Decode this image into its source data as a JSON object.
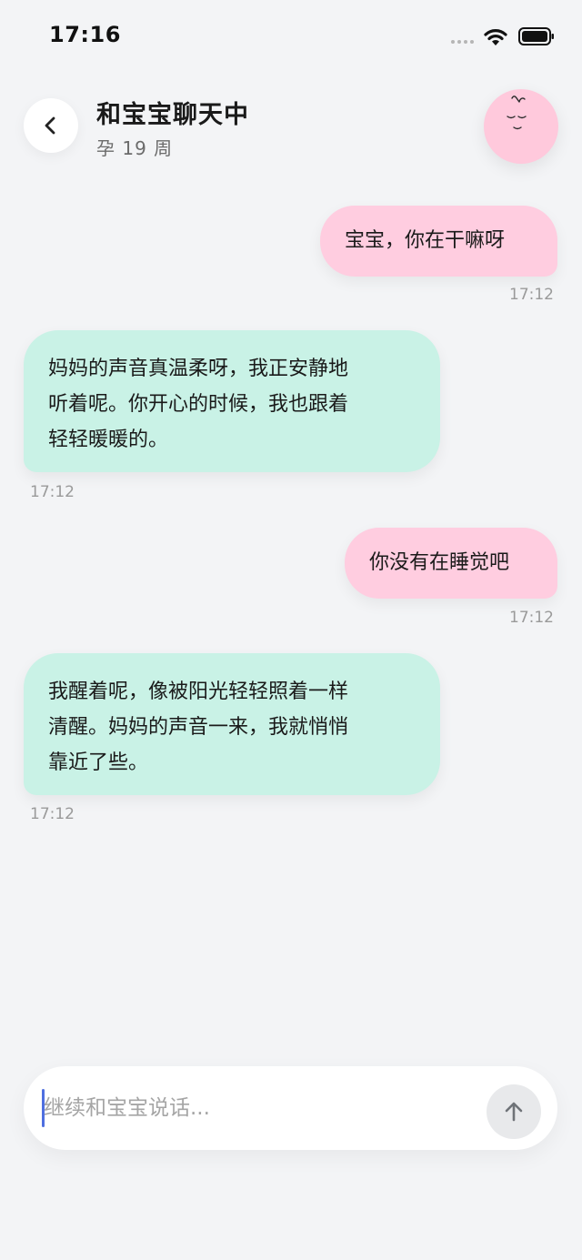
{
  "status_bar": {
    "time": "17:16"
  },
  "header": {
    "title": "和宝宝聊天中",
    "subtitle": "孕 19 周"
  },
  "messages": [
    {
      "sender": "user",
      "text": "宝宝，你在干嘛呀",
      "time": "17:12"
    },
    {
      "sender": "baby",
      "text": "妈妈的声音真温柔呀，我正安静地\n听着呢。你开心的时候，我也跟着\n轻轻暖暖的。",
      "time": "17:12"
    },
    {
      "sender": "user",
      "text": "你没有在睡觉吧",
      "time": "17:12"
    },
    {
      "sender": "baby",
      "text": "我醒着呢，像被阳光轻轻照着一样\n清醒。妈妈的声音一来，我就悄悄\n靠近了些。",
      "time": "17:12"
    }
  ],
  "composer": {
    "placeholder": "继续和宝宝说话..."
  },
  "colors": {
    "background": "#f3f4f6",
    "user_bubble": "#ffcde0",
    "baby_bubble": "#c9f2e6",
    "avatar": "#ffc9dc",
    "caret": "#4f6fe0"
  },
  "icons": {
    "back": "chevron-left-icon",
    "send": "arrow-up-icon",
    "avatar": "sleeping-baby-face-icon",
    "wifi": "wifi-icon",
    "battery": "battery-icon",
    "signal": "signal-dots-icon"
  }
}
